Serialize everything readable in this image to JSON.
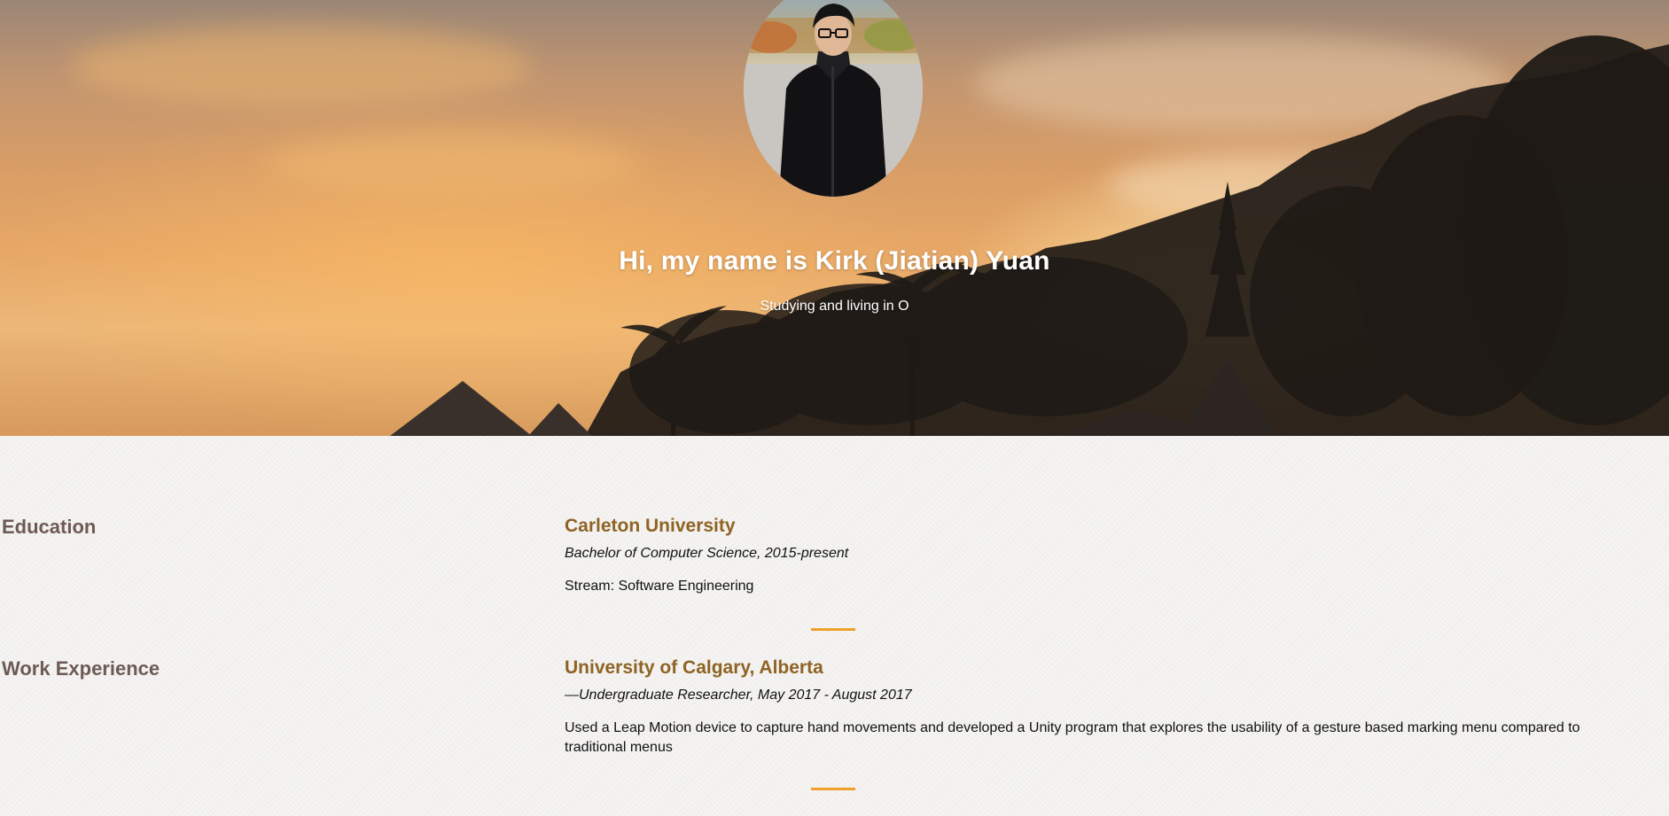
{
  "hero": {
    "title": "Hi, my name is Kirk (Jiatian) Yuan",
    "subtitle": "Studying and living in O"
  },
  "sections": {
    "education": {
      "heading": "Education",
      "entries": [
        {
          "title": "Carleton University",
          "meta": "Bachelor of Computer Science, 2015-present",
          "text": "Stream: Software Engineering"
        }
      ]
    },
    "work": {
      "heading": "Work Experience",
      "entries": [
        {
          "title": "University of Calgary, Alberta",
          "meta": "—Undergraduate Researcher, May 2017 - August 2017",
          "text": "Used a Leap Motion device to capture hand movements and developed a Unity program that explores the usability of a gesture based marking menu compared to traditional menus"
        }
      ]
    }
  },
  "colors": {
    "accent": "#f0a02a",
    "entry_title": "#8f6324",
    "section_heading": "#6e5a55"
  }
}
